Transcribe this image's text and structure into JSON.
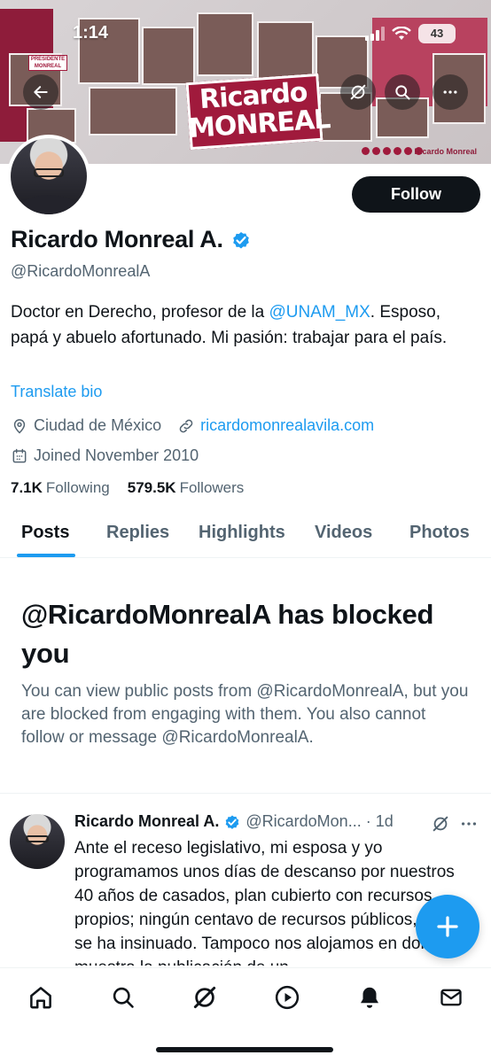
{
  "status_bar": {
    "time": "1:14",
    "battery": "43"
  },
  "banner": {
    "brand_line1": "Ricardo",
    "brand_line2": "MONREAL",
    "brand_handle": "Ricardo Monreal",
    "sign_text": "PRESIDENTE MONREAL"
  },
  "profile": {
    "name": "Ricardo Monreal A.",
    "handle": "@RicardoMonrealA",
    "bio_before": "Doctor en Derecho, profesor de la ",
    "bio_mention": "@UNAM_MX",
    "bio_after": ". Esposo, papá y abuelo afortunado. Mi pasión: trabajar para el país.",
    "translate_label": "Translate bio",
    "location": "Ciudad de México",
    "website": "ricardomonrealavila.com",
    "joined": "Joined November 2010",
    "following_count": "7.1K",
    "following_label": "Following",
    "followers_count": "579.5K",
    "followers_label": "Followers"
  },
  "actions": {
    "follow_label": "Follow"
  },
  "tabs": [
    {
      "label": "Posts",
      "active": true
    },
    {
      "label": "Replies"
    },
    {
      "label": "Highlights"
    },
    {
      "label": "Videos"
    },
    {
      "label": "Photos"
    }
  ],
  "blocked": {
    "title": "@RicardoMonrealA has blocked you",
    "description": "You can view public posts from @RicardoMonrealA, but you are blocked from engaging with them. You also cannot follow or message @RicardoMonrealA."
  },
  "post": {
    "author_name": "Ricardo Monreal A.",
    "author_handle": "@RicardoMon...",
    "time": "1d",
    "text": "Ante el receso legislativo, mi esposa y yo programamos unos días de descanso por nuestros 40 años de casados, plan cubierto con recursos propios; ningún centavo de recursos públicos, como se ha insinuado. Tampoco nos alojamos en donde muestra la publicación de un"
  },
  "colors": {
    "accent": "#1d9bf0",
    "text": "#0f1419",
    "secondary": "#536471",
    "brand": "#a01a3c"
  },
  "icons": [
    "back-arrow-icon",
    "grok-icon",
    "search-icon",
    "more-icon",
    "verified-badge-icon",
    "location-icon",
    "link-icon",
    "calendar-icon",
    "home-icon",
    "explore-icon",
    "play-icon",
    "notifications-icon",
    "messages-icon",
    "compose-plus-icon"
  ]
}
